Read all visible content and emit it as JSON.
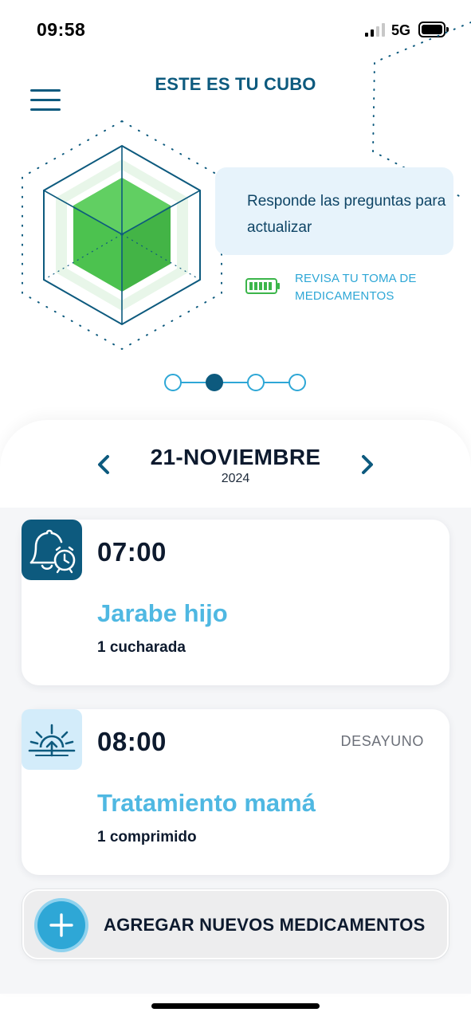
{
  "status_bar": {
    "time": "09:58",
    "network": "5G",
    "signal_bars_active": 2,
    "battery_level": 1.0
  },
  "header": {
    "title": "ESTE ES TU CUBO"
  },
  "cube_panel": {
    "hint": "Responde las preguntas para actualizar",
    "med_check_label": "REVISA TU TOMA DE MEDICAMENTOS",
    "cube_color": "#4cc24f"
  },
  "pager": {
    "page_count": 4,
    "active_index": 1
  },
  "date_nav": {
    "date": "21-NOVIEMBRE",
    "year": "2024"
  },
  "doses": [
    {
      "time": "07:00",
      "meal": "",
      "medication": "Jarabe hijo",
      "amount": "1 cucharada",
      "icon": "alarm-bell-icon"
    },
    {
      "time": "08:00",
      "meal": "DESAYUNO",
      "medication": "Tratamiento mamá",
      "amount": "1 comprimido",
      "icon": "sunrise-icon"
    }
  ],
  "add_button": {
    "label": "AGREGAR NUEVOS MEDICAMENTOS"
  },
  "colors": {
    "primary_dark": "#0d5a7e",
    "accent": "#2ea7d6",
    "med_name": "#4fb8e2",
    "cube_green": "#4cc24f"
  }
}
